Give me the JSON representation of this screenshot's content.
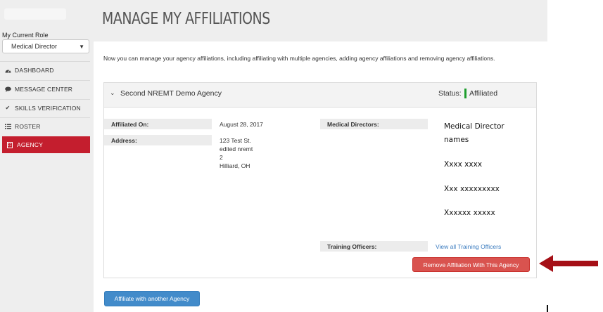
{
  "sidebar": {
    "role_label": "My Current Role",
    "role_value": "Medical Director",
    "nav": [
      {
        "label": "DASHBOARD",
        "icon": "dashboard-icon"
      },
      {
        "label": "MESSAGE CENTER",
        "icon": "speech-bubble-icon"
      },
      {
        "label": "SKILLS VERIFICATION",
        "icon": "checkmark-icon"
      },
      {
        "label": "ROSTER",
        "icon": "list-icon"
      },
      {
        "label": "AGENCY",
        "icon": "building-icon",
        "active": true
      }
    ]
  },
  "page": {
    "title": "MANAGE MY AFFILIATIONS",
    "intro": "Now you can manage your agency affiliations, including affiliating with multiple agencies, adding agency affiliations and removing agency affiliations."
  },
  "agency": {
    "name": "Second NREMT Demo Agency",
    "status_label": "Status:",
    "status_value": "Affiliated",
    "status_color": "#1e9e2e",
    "affiliated_on_label": "Affiliated On:",
    "affiliated_on_value": "August 28, 2017",
    "address_label": "Address:",
    "address_lines": [
      "123 Test St.",
      "edited nremt",
      "2",
      "Hilliard, OH"
    ],
    "medical_directors_label": "Medical Directors:",
    "medical_directors_note_1": "Medical Director",
    "medical_directors_note_2": "names",
    "medical_directors": [
      "Xxxx xxxx",
      "Xxx xxxxxxxxx",
      "Xxxxxx xxxxx"
    ],
    "training_officers_label": "Training Officers:",
    "training_officers_link": "View all Training Officers",
    "remove_button": "Remove Affiliation With This Agency"
  },
  "affiliate_button": "Affiliate with another Agency",
  "colors": {
    "accent_red": "#c41e2e",
    "remove_button": "#d9534f",
    "primary_button": "#428bca",
    "annotation_arrow": "#a50f16"
  }
}
